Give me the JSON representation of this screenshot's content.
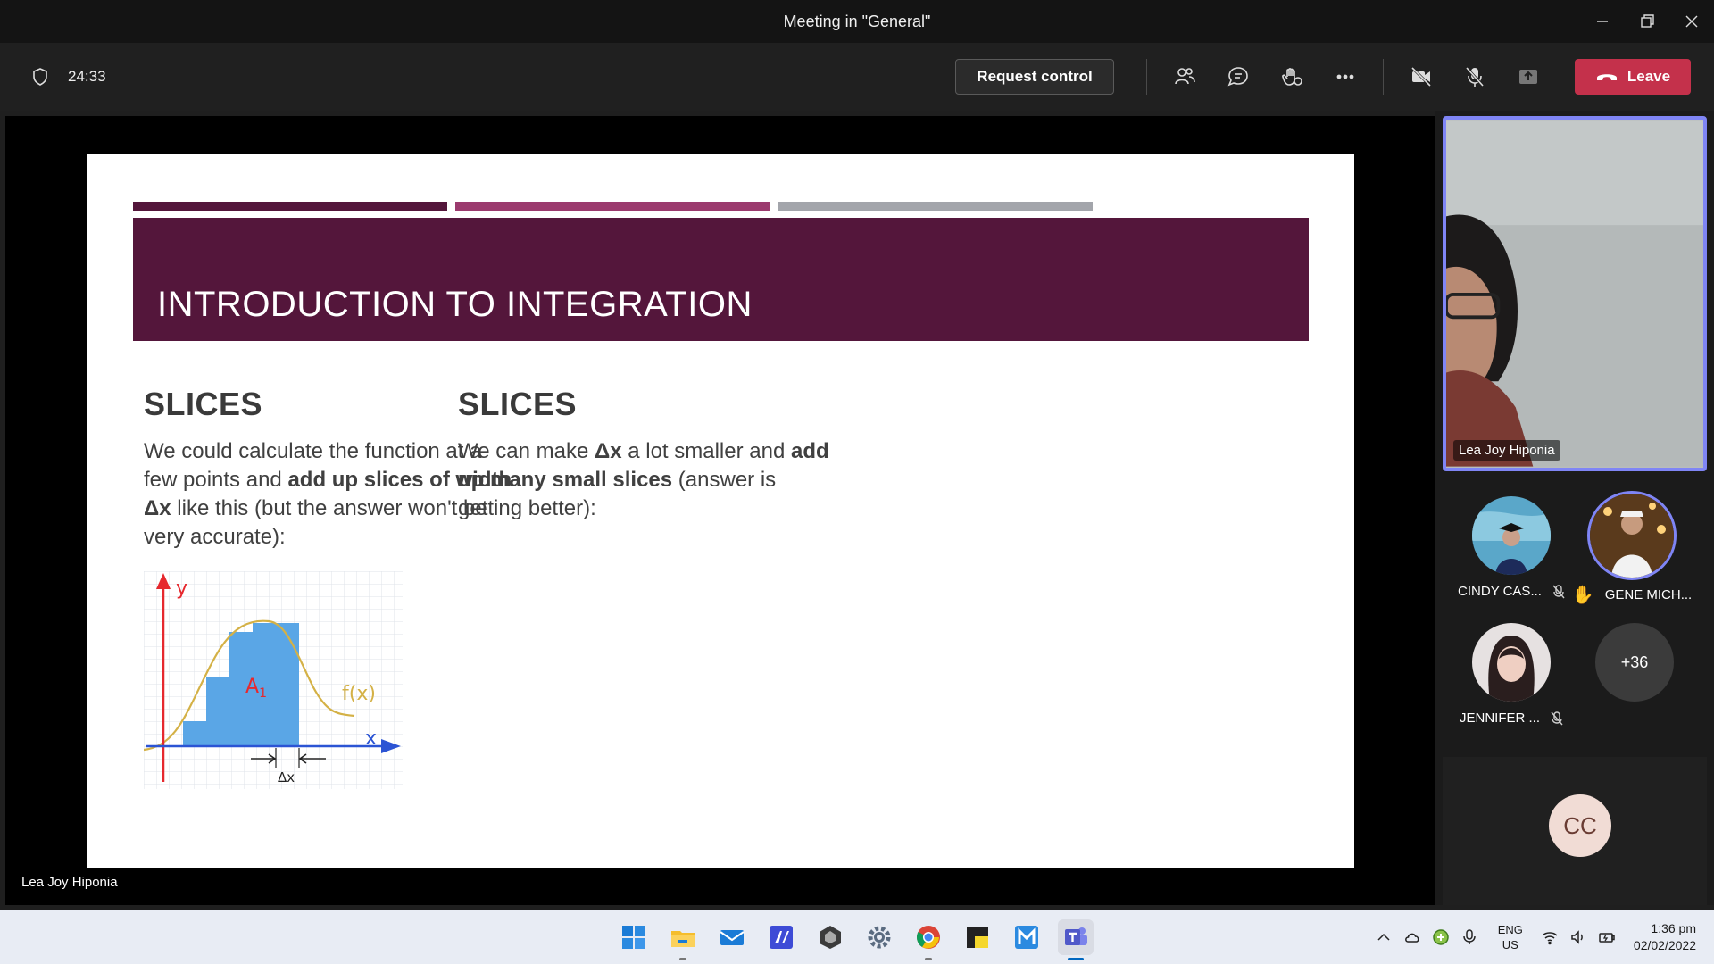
{
  "window": {
    "title": "Meeting in \"General\""
  },
  "toolbar": {
    "timer": "24:33",
    "request_control_label": "Request control",
    "leave_label": "Leave"
  },
  "slide": {
    "title": "INTRODUCTION TO INTEGRATION",
    "bar_colors": [
      "#54163b",
      "#9b3a6e",
      "#a3a5ab"
    ],
    "banner_color": "#54163b",
    "left": {
      "heading": "SLICES",
      "t1": "We could calculate the function at a few points and ",
      "b1": "add up slices of width Δx",
      "t2": " like this (but the answer won't be very accurate):"
    },
    "right": {
      "heading": "SLICES",
      "t1": "We can make ",
      "b1": "Δx",
      "t2": " a lot smaller and ",
      "b2": "add up many small slices",
      "t3": " (answer is getting better):"
    },
    "graph": {
      "y_label": "y",
      "x_label": "x",
      "fx_label": "f(x)",
      "area_label": "A",
      "area_sub": "1",
      "dx_label": "Δx"
    }
  },
  "presenter_label": "Lea Joy Hiponia",
  "panel": {
    "speaker_name": "Lea Joy Hiponia",
    "participants": [
      {
        "name": "CINDY CAS...",
        "muted": true
      },
      {
        "name": "GENE MICH...",
        "hand_raised": true
      },
      {
        "name": "JENNIFER ...",
        "muted": true
      }
    ],
    "more_count": "+36",
    "cc_initials": "CC"
  },
  "taskbar": {
    "apps": [
      "windows-start-icon",
      "file-explorer-icon",
      "mail-icon",
      "pen-app-icon",
      "unity-icon",
      "settings-icon",
      "chrome-icon",
      "sticky-notes-icon",
      "mindmap-app-icon",
      "teams-icon"
    ],
    "lang_line1": "ENG",
    "lang_line2": "US",
    "time": "1:36 pm",
    "date": "02/02/2022"
  }
}
